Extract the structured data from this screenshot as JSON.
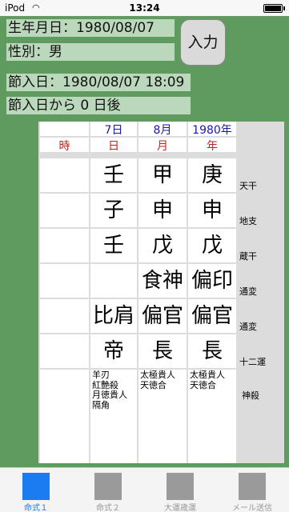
{
  "status": {
    "carrier": "iPod",
    "time": "13:24"
  },
  "birth": "生年月日：1980/08/07",
  "gender": "性別：男",
  "input_button": "入力",
  "setsuiri": "節入日：1980/08/07 18:09",
  "after_setsuiri": "節入日から 0 日後",
  "header": {
    "values": [
      "7日",
      "8月",
      "1980年"
    ],
    "labels": [
      "時",
      "日",
      "月",
      "年"
    ]
  },
  "rows": [
    {
      "cells": [
        "",
        "壬",
        "甲",
        "庚"
      ],
      "label": "天干"
    },
    {
      "cells": [
        "",
        "子",
        "申",
        "申"
      ],
      "label": "地支"
    },
    {
      "cells": [
        "",
        "壬",
        "戊",
        "戊"
      ],
      "label": "蔵干"
    },
    {
      "cells": [
        "",
        "",
        "食神",
        "偏印"
      ],
      "label": "通変"
    },
    {
      "cells": [
        "",
        "比肩",
        "偏官",
        "偏官"
      ],
      "label": "通変"
    },
    {
      "cells": [
        "",
        "帝",
        "長",
        "長"
      ],
      "label": "十二運"
    }
  ],
  "shinsatsu": {
    "label": "神殺",
    "day": "羊刃\n紅艶殺\n月徳貴人\n隔角",
    "month": "太極貴人\n天徳合",
    "year": "太極貴人\n天徳合"
  },
  "tabs": [
    {
      "label": "命式１",
      "active": true
    },
    {
      "label": "命式２",
      "active": false
    },
    {
      "label": "大運歳運",
      "active": false
    },
    {
      "label": "メール送信",
      "active": false
    }
  ]
}
